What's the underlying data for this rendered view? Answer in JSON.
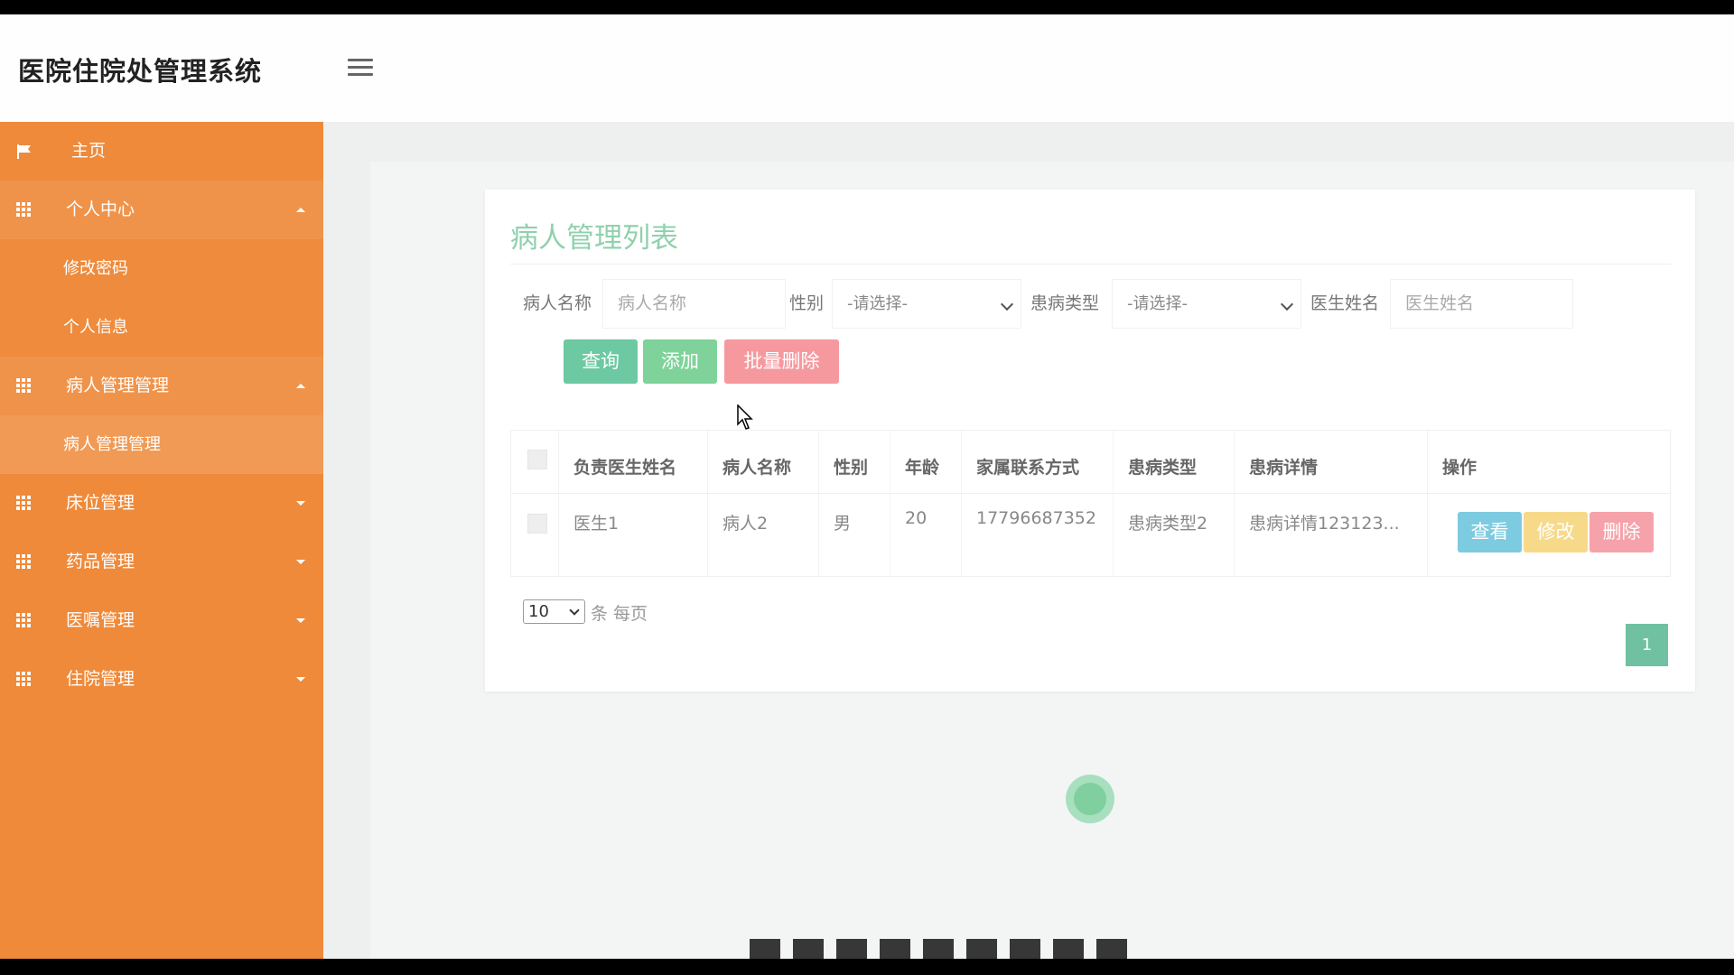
{
  "app": {
    "title": "医院住院处管理系统"
  },
  "sidebar": {
    "items": [
      {
        "label": "主页"
      },
      {
        "label": "个人中心",
        "children": [
          {
            "label": "修改密码"
          },
          {
            "label": "个人信息"
          }
        ]
      },
      {
        "label": "病人管理管理",
        "children": [
          {
            "label": "病人管理管理"
          }
        ]
      },
      {
        "label": "床位管理"
      },
      {
        "label": "药品管理"
      },
      {
        "label": "医嘱管理"
      },
      {
        "label": "住院管理"
      }
    ]
  },
  "page": {
    "title": "病人管理列表",
    "filters": {
      "patient_name_label": "病人名称",
      "patient_name_placeholder": "病人名称",
      "gender_label": "性别",
      "gender_value": "-请选择-",
      "disease_type_label": "患病类型",
      "disease_type_value": "-请选择-",
      "doctor_name_label": "医生姓名",
      "doctor_name_placeholder": "医生姓名"
    },
    "buttons": {
      "query": "查询",
      "add": "添加",
      "batch_delete": "批量删除"
    }
  },
  "table": {
    "columns": [
      "负责医生姓名",
      "病人名称",
      "性别",
      "年龄",
      "家属联系方式",
      "患病类型",
      "患病详情",
      "操作"
    ],
    "rows": [
      {
        "doctor": "医生1",
        "patient": "病人2",
        "gender": "男",
        "age": "20",
        "contact": "17796687352",
        "disease_type": "患病类型2",
        "disease_detail": "患病详情123123...",
        "actions": {
          "view": "查看",
          "edit": "修改",
          "delete": "删除"
        }
      }
    ]
  },
  "pagination": {
    "page_size": "10",
    "per_page_label": "条 每页",
    "current_page": "1"
  },
  "colors": {
    "sidebar": "#ef8a3a",
    "title_green": "#8fd1ad",
    "query": "#6cc9a1",
    "add": "#7fd39a",
    "batch_delete": "#f6999f",
    "view": "#7dcbe0",
    "edit": "#f7d98a",
    "delete": "#f6a2aa",
    "page_active": "#6fc1a2"
  }
}
